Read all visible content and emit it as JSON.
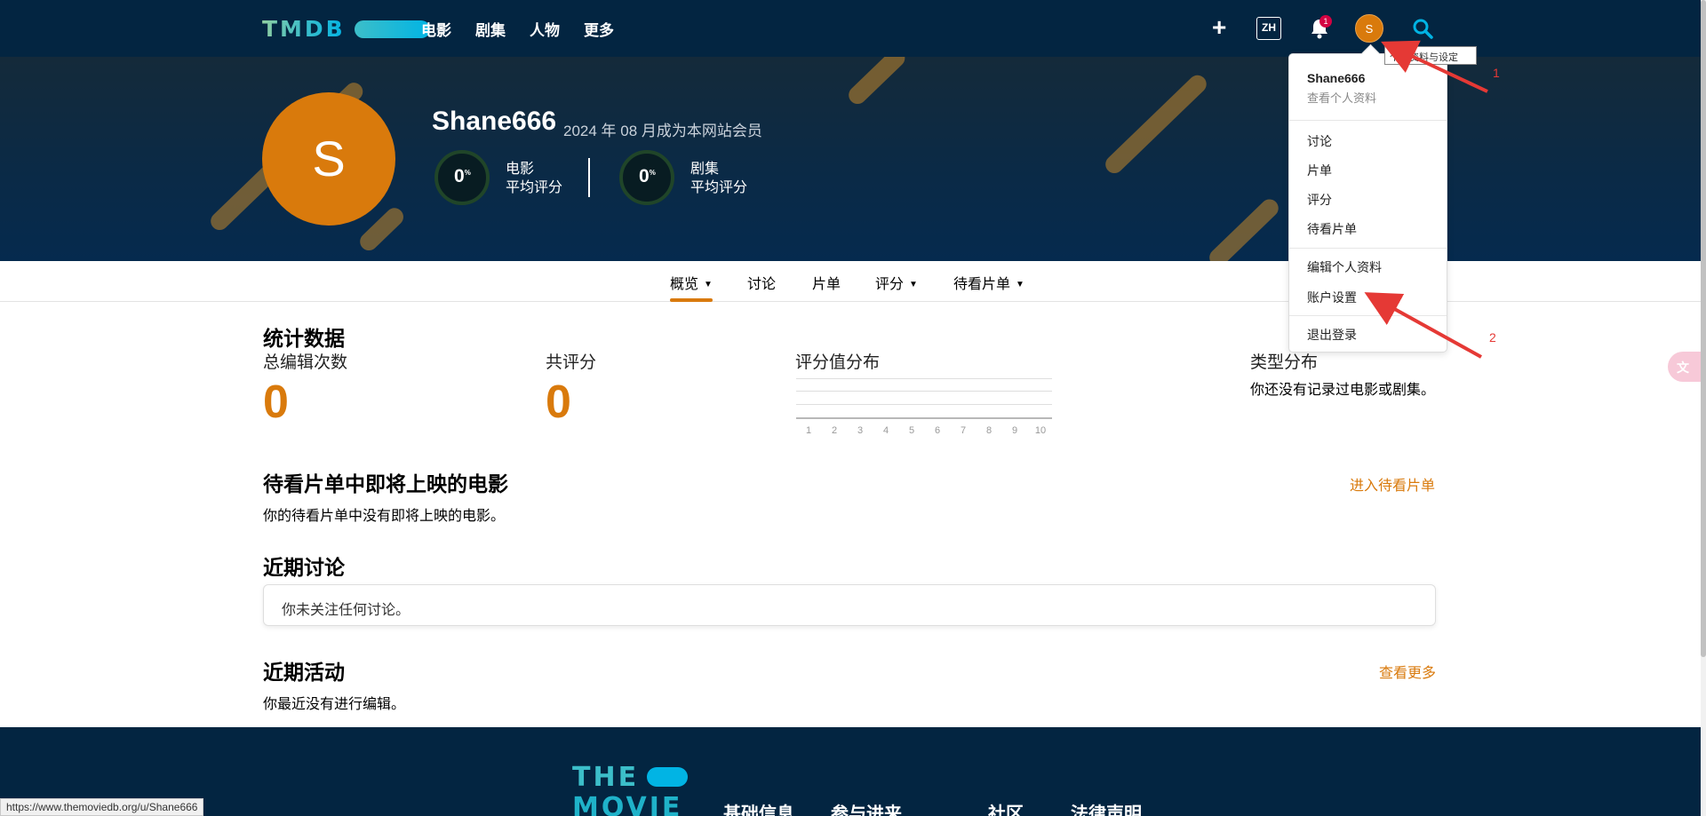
{
  "nav": {
    "logo_text": "TMDB",
    "items": [
      "电影",
      "剧集",
      "人物",
      "更多"
    ],
    "lang": "ZH",
    "notif_count": "1",
    "avatar_initial": "S"
  },
  "profile": {
    "initial": "S",
    "username": "Shane666",
    "member_since": "2024 年 08 月成为本网站会员",
    "movie_score": "0",
    "movie_label_1": "电影",
    "movie_label_2": "平均评分",
    "tv_score": "0",
    "tv_label_1": "剧集",
    "tv_label_2": "平均评分",
    "percent": "%"
  },
  "subnav": {
    "overview": "概览",
    "discussions": "讨论",
    "lists": "片单",
    "ratings": "评分",
    "watchlist": "待看片单"
  },
  "stats": {
    "title": "统计数据",
    "edits_label": "总编辑次数",
    "edits_value": "0",
    "ratings_label": "共评分",
    "ratings_value": "0",
    "dist_label": "评分值分布",
    "dist_ticks": [
      "1",
      "2",
      "3",
      "4",
      "5",
      "6",
      "7",
      "8",
      "9",
      "10"
    ],
    "genre_label": "类型分布",
    "genre_text": "你还没有记录过电影或剧集。"
  },
  "upcoming": {
    "title": "待看片单中即将上映的电影",
    "text": "你的待看片单中没有即将上映的电影。",
    "link": "进入待看片单"
  },
  "discussions": {
    "title": "近期讨论",
    "text": "你未关注任何讨论。"
  },
  "activity": {
    "title": "近期活动",
    "text": "你最近没有进行编辑。",
    "link": "查看更多"
  },
  "footer": {
    "logo_top": "THE",
    "logo_bottom": "MOVIE",
    "headings": [
      "基础信息",
      "参与进来",
      "社区",
      "法律声明"
    ]
  },
  "dropdown": {
    "name": "Shane666",
    "view_profile": "查看个人资料",
    "items_group1": [
      "讨论",
      "片单",
      "评分",
      "待看片单"
    ],
    "edit_profile": "编辑个人资料",
    "account_settings": "账户设置",
    "logout": "退出登录"
  },
  "tooltip": "个人资料与设定",
  "annotations": [
    "1",
    "2"
  ],
  "status_url": "https://www.themoviedb.org/u/Shane666",
  "colors": {
    "navy": "#032541",
    "accent_orange": "#d97a0c",
    "annotation_red": "#e53935"
  }
}
